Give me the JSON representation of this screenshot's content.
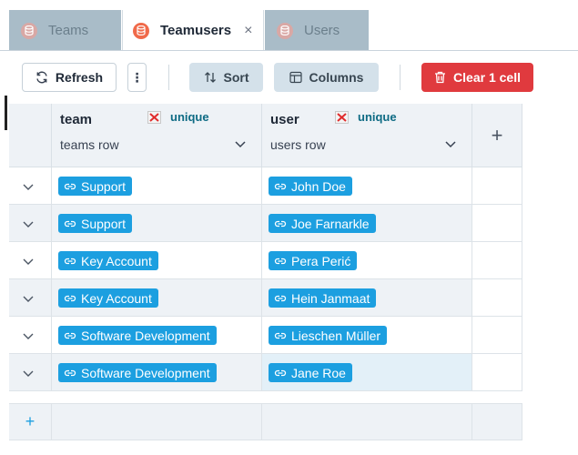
{
  "tabs": [
    {
      "label": "Teams",
      "active": false
    },
    {
      "label": "Teamusers",
      "active": true,
      "close": "×"
    },
    {
      "label": "Users",
      "active": false
    }
  ],
  "toolbar": {
    "refresh_label": "Refresh",
    "more_label": "⋮",
    "sort_label": "Sort",
    "columns_label": "Columns",
    "clear_label": "Clear 1 cell"
  },
  "columns": [
    {
      "title": "team",
      "flag": "unique",
      "subtitle": "teams row"
    },
    {
      "title": "user",
      "flag": "unique",
      "subtitle": "users row"
    }
  ],
  "add_column_label": "+",
  "rows": [
    {
      "team": "Support",
      "user": "John Doe"
    },
    {
      "team": "Support",
      "user": "Joe Farnarkle"
    },
    {
      "team": "Key Account",
      "user": "Pera Perić"
    },
    {
      "team": "Key Account",
      "user": "Hein Janmaat"
    },
    {
      "team": "Software Development",
      "user": "Lieschen Müller"
    },
    {
      "team": "Software Development",
      "user": "Jane Roe"
    }
  ],
  "add_row_label": "+",
  "colors": {
    "accent": "#1c9fe0",
    "danger": "#e03a3e",
    "tab_inactive": "#a9bcc8",
    "db_icon": "#f06a4a"
  }
}
